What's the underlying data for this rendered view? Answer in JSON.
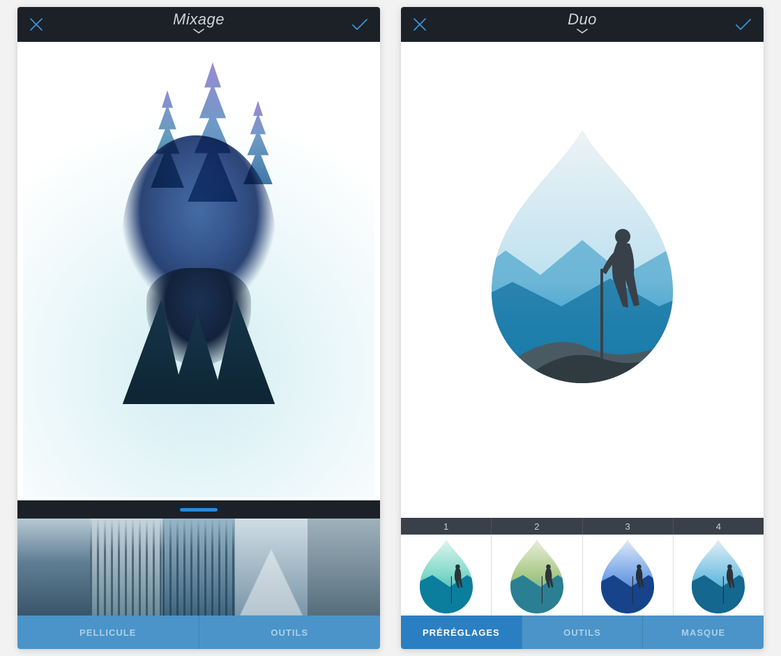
{
  "screens": [
    {
      "title": "Mixage",
      "tabs": [
        {
          "label": "PELLICULE",
          "active": false
        },
        {
          "label": "OUTILS",
          "active": false
        }
      ]
    },
    {
      "title": "Duo",
      "presets": [
        "1",
        "2",
        "3",
        "4"
      ],
      "tabs": [
        {
          "label": "PRÉRÉGLAGES",
          "active": true
        },
        {
          "label": "OUTILS",
          "active": false
        },
        {
          "label": "MASQUE",
          "active": false
        }
      ]
    }
  ],
  "colors": {
    "accent": "#3a93d6",
    "topbar": "#1c2128",
    "tab_bg": "#4a94c9",
    "tab_active": "#2a7fc2"
  }
}
